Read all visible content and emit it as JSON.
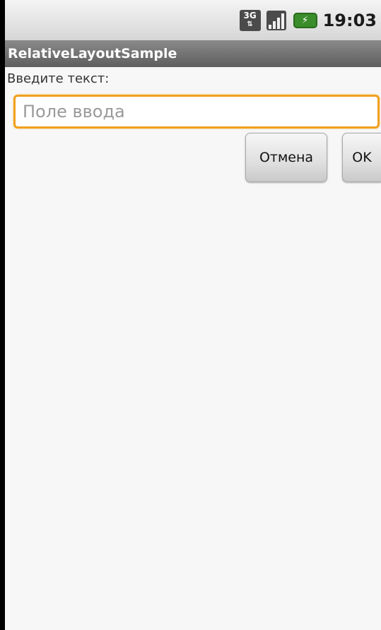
{
  "status_bar": {
    "network_type": "3G",
    "time": "19:03",
    "icons": [
      "3g-icon",
      "signal-icon",
      "battery-icon"
    ]
  },
  "app": {
    "title": "RelativeLayoutSample"
  },
  "form": {
    "label": "Введите текст:",
    "input_placeholder": "Поле ввода",
    "input_value": "",
    "cancel_label": "Отмена",
    "ok_label": "OK"
  },
  "colors": {
    "focus_border": "#f0a020",
    "title_bar": "#6e6e6e",
    "background": "#f7f7f7"
  }
}
